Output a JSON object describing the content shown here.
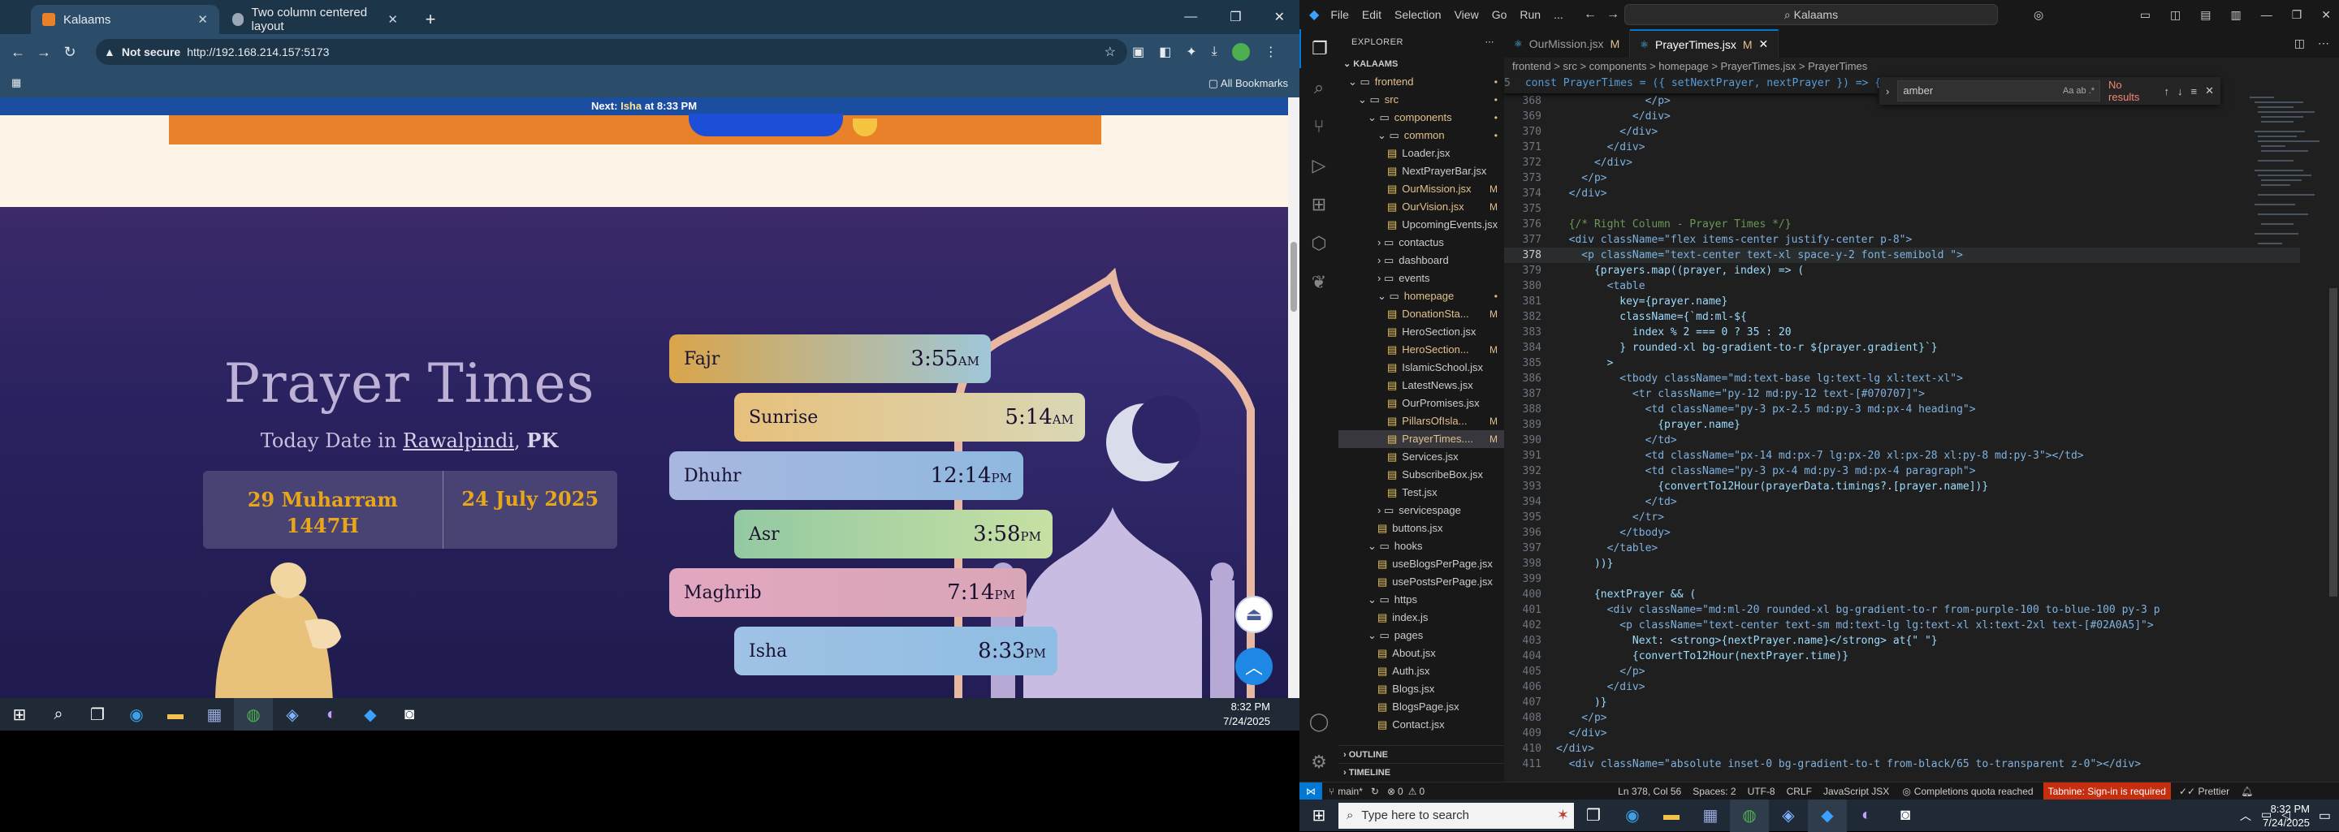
{
  "browser": {
    "tabs": [
      {
        "label": "Kalaams",
        "active": true
      },
      {
        "label": "Two column centered layout",
        "active": false
      }
    ],
    "address": {
      "security": "Not secure",
      "url": "http://192.168.214.157:5173"
    },
    "bookmarks_label": "All Bookmarks"
  },
  "page": {
    "next_bar": {
      "prefix": "Next:",
      "prayer": "Isha",
      "middle": "at",
      "time": "8:33 PM"
    },
    "title": "Prayer Times",
    "date_prefix": "Today Date in",
    "city": "Rawalpindi",
    "country": "PK",
    "hijri_date": "29 Muharram 1447H",
    "gregorian_date": "24 July 2025",
    "prayers": [
      {
        "name": "Fajr",
        "time": "3:55",
        "ampm": "AM",
        "colors": [
          "#d9a54a",
          "#9fc7d8"
        ]
      },
      {
        "name": "Sunrise",
        "time": "5:14",
        "ampm": "AM",
        "colors": [
          "#e7c07c",
          "#d9d7b6"
        ]
      },
      {
        "name": "Dhuhr",
        "time": "12:14",
        "ampm": "PM",
        "colors": [
          "#a8b7e0",
          "#8fb8df"
        ]
      },
      {
        "name": "Asr",
        "time": "3:58",
        "ampm": "PM",
        "colors": [
          "#93c9a2",
          "#c7e0a3"
        ]
      },
      {
        "name": "Maghrib",
        "time": "7:14",
        "ampm": "PM",
        "colors": [
          "#e2a7c0",
          "#d9a6b7"
        ]
      },
      {
        "name": "Isha",
        "time": "8:33",
        "ampm": "PM",
        "colors": [
          "#9fc2e5",
          "#8fbde3"
        ]
      }
    ]
  },
  "left_taskbar": {
    "time": "8:32 PM",
    "date": "7/24/2025"
  },
  "vscode": {
    "menu": [
      "File",
      "Edit",
      "Selection",
      "View",
      "Go",
      "Run",
      "..."
    ],
    "command_center": "Kalaams",
    "explorer_title": "EXPLORER",
    "workspace": "KALAAMS",
    "tree": [
      {
        "label": "frontend",
        "depth": 1,
        "type": "folder-open",
        "badge": "•"
      },
      {
        "label": "src",
        "depth": 2,
        "type": "folder-open",
        "badge": "•"
      },
      {
        "label": "components",
        "depth": 3,
        "type": "folder-open",
        "badge": "•"
      },
      {
        "label": "common",
        "depth": 4,
        "type": "folder-open",
        "badge": "•"
      },
      {
        "label": "Loader.jsx",
        "depth": 5,
        "type": "file",
        "badge": ""
      },
      {
        "label": "NextPrayerBar.jsx",
        "depth": 5,
        "type": "file",
        "badge": ""
      },
      {
        "label": "OurMission.jsx",
        "depth": 5,
        "type": "file",
        "badge": "M"
      },
      {
        "label": "OurVision.jsx",
        "depth": 5,
        "type": "file",
        "badge": "M"
      },
      {
        "label": "UpcomingEvents.jsx",
        "depth": 5,
        "type": "file",
        "badge": ""
      },
      {
        "label": "contactus",
        "depth": 4,
        "type": "folder",
        "badge": ""
      },
      {
        "label": "dashboard",
        "depth": 4,
        "type": "folder",
        "badge": ""
      },
      {
        "label": "events",
        "depth": 4,
        "type": "folder",
        "badge": ""
      },
      {
        "label": "homepage",
        "depth": 4,
        "type": "folder-open",
        "badge": "•"
      },
      {
        "label": "DonationSta...",
        "depth": 5,
        "type": "file",
        "badge": "M"
      },
      {
        "label": "HeroSection.jsx",
        "depth": 5,
        "type": "file",
        "badge": ""
      },
      {
        "label": "HeroSection...",
        "depth": 5,
        "type": "file",
        "badge": "M"
      },
      {
        "label": "IslamicSchool.jsx",
        "depth": 5,
        "type": "file",
        "badge": ""
      },
      {
        "label": "LatestNews.jsx",
        "depth": 5,
        "type": "file",
        "badge": ""
      },
      {
        "label": "OurPromises.jsx",
        "depth": 5,
        "type": "file",
        "badge": ""
      },
      {
        "label": "PillarsOfIsla...",
        "depth": 5,
        "type": "file",
        "badge": "M"
      },
      {
        "label": "PrayerTimes....",
        "depth": 5,
        "type": "file",
        "badge": "M",
        "selected": true
      },
      {
        "label": "Services.jsx",
        "depth": 5,
        "type": "file",
        "badge": ""
      },
      {
        "label": "SubscribeBox.jsx",
        "depth": 5,
        "type": "file",
        "badge": ""
      },
      {
        "label": "Test.jsx",
        "depth": 5,
        "type": "file",
        "badge": ""
      },
      {
        "label": "servicespage",
        "depth": 4,
        "type": "folder",
        "badge": ""
      },
      {
        "label": "buttons.jsx",
        "depth": 4,
        "type": "file",
        "badge": ""
      },
      {
        "label": "hooks",
        "depth": 3,
        "type": "folder-open",
        "badge": ""
      },
      {
        "label": "useBlogsPerPage.jsx",
        "depth": 4,
        "type": "file",
        "badge": ""
      },
      {
        "label": "usePostsPerPage.jsx",
        "depth": 4,
        "type": "file",
        "badge": ""
      },
      {
        "label": "https",
        "depth": 3,
        "type": "folder-open",
        "badge": ""
      },
      {
        "label": "index.js",
        "depth": 4,
        "type": "file",
        "badge": ""
      },
      {
        "label": "pages",
        "depth": 3,
        "type": "folder-open",
        "badge": ""
      },
      {
        "label": "About.jsx",
        "depth": 4,
        "type": "file",
        "badge": ""
      },
      {
        "label": "Auth.jsx",
        "depth": 4,
        "type": "file",
        "badge": ""
      },
      {
        "label": "Blogs.jsx",
        "depth": 4,
        "type": "file",
        "badge": ""
      },
      {
        "label": "BlogsPage.jsx",
        "depth": 4,
        "type": "file",
        "badge": ""
      },
      {
        "label": "Contact.jsx",
        "depth": 4,
        "type": "file",
        "badge": ""
      }
    ],
    "outline": "OUTLINE",
    "timeline": "TIMELINE",
    "editor_tabs": [
      {
        "label": "OurMission.jsx",
        "badge": "M",
        "active": false
      },
      {
        "label": "PrayerTimes.jsx",
        "badge": "M",
        "active": true
      }
    ],
    "breadcrumbs": "frontend > src > components > homepage > PrayerTimes.jsx > PrayerTimes",
    "sticky": {
      "num": "5",
      "text": "const PrayerTimes = ({ setNextPrayer, nextPrayer }) => {"
    },
    "find": {
      "query": "amber",
      "result": "No results"
    },
    "lines": [
      {
        "n": "368",
        "t": "              </p>"
      },
      {
        "n": "369",
        "t": "            </div>"
      },
      {
        "n": "370",
        "t": "          </div>"
      },
      {
        "n": "371",
        "t": "        </div>"
      },
      {
        "n": "372",
        "t": "      </div>"
      },
      {
        "n": "373",
        "t": "    </p>"
      },
      {
        "n": "374",
        "t": "  </div>"
      },
      {
        "n": "375",
        "t": ""
      },
      {
        "n": "376",
        "t": "  {/* Right Column - Prayer Times */}"
      },
      {
        "n": "377",
        "t": "  <div className=\"flex items-center justify-center p-8\">"
      },
      {
        "n": "378",
        "t": "    <p className=\"text-center text-xl space-y-2 font-semibold \">"
      },
      {
        "n": "379",
        "t": "      {prayers.map((prayer, index) => ("
      },
      {
        "n": "380",
        "t": "        <table"
      },
      {
        "n": "381",
        "t": "          key={prayer.name}"
      },
      {
        "n": "382",
        "t": "          className={`md:ml-${"
      },
      {
        "n": "383",
        "t": "            index % 2 === 0 ? 35 : 20"
      },
      {
        "n": "384",
        "t": "          } rounded-xl bg-gradient-to-r ${prayer.gradient}`}"
      },
      {
        "n": "385",
        "t": "        >"
      },
      {
        "n": "386",
        "t": "          <tbody className=\"md:text-base lg:text-lg xl:text-xl\">"
      },
      {
        "n": "387",
        "t": "            <tr className=\"py-12 md:py-12 text-[#070707]\">"
      },
      {
        "n": "388",
        "t": "              <td className=\"py-3 px-2.5 md:py-3 md:px-4 heading\">"
      },
      {
        "n": "389",
        "t": "                {prayer.name}"
      },
      {
        "n": "390",
        "t": "              </td>"
      },
      {
        "n": "391",
        "t": "              <td className=\"px-14 md:px-7 lg:px-20 xl:px-28 xl:py-8 md:py-3\"></td>"
      },
      {
        "n": "392",
        "t": "              <td className=\"py-3 px-4 md:py-3 md:px-4 paragraph\">"
      },
      {
        "n": "393",
        "t": "                {convertTo12Hour(prayerData.timings?.[prayer.name])}"
      },
      {
        "n": "394",
        "t": "              </td>"
      },
      {
        "n": "395",
        "t": "            </tr>"
      },
      {
        "n": "396",
        "t": "          </tbody>"
      },
      {
        "n": "397",
        "t": "        </table>"
      },
      {
        "n": "398",
        "t": "      ))}"
      },
      {
        "n": "399",
        "t": ""
      },
      {
        "n": "400",
        "t": "      {nextPrayer && ("
      },
      {
        "n": "401",
        "t": "        <div className=\"md:ml-20 rounded-xl bg-gradient-to-r from-purple-100 to-blue-100 py-3 p"
      },
      {
        "n": "402",
        "t": "          <p className=\"text-center text-sm md:text-lg lg:text-xl xl:text-2xl text-[#02A0A5]\">"
      },
      {
        "n": "403",
        "t": "            Next: <strong>{nextPrayer.name}</strong> at{\" \"}"
      },
      {
        "n": "404",
        "t": "            {convertTo12Hour(nextPrayer.time)}"
      },
      {
        "n": "405",
        "t": "          </p>"
      },
      {
        "n": "406",
        "t": "        </div>"
      },
      {
        "n": "407",
        "t": "      )}"
      },
      {
        "n": "408",
        "t": "    </p>"
      },
      {
        "n": "409",
        "t": "  </div>"
      },
      {
        "n": "410",
        "t": "</div>"
      },
      {
        "n": "411",
        "t": "  <div className=\"absolute inset-0 bg-gradient-to-t from-black/65 to-transparent z-0\"></div>"
      }
    ],
    "current_line": "378",
    "status": {
      "branch": "main*",
      "errors": "0",
      "warnings": "0",
      "position": "Ln 378, Col 56",
      "spaces": "Spaces: 2",
      "encoding": "UTF-8",
      "eol": "CRLF",
      "language": "JavaScript JSX",
      "quota": "Completions quota reached",
      "tabnine": "Tabnine: Sign-in is required",
      "prettier": "Prettier"
    }
  },
  "right_taskbar": {
    "search_placeholder": "Type here to search",
    "time": "8:32 PM",
    "date": "7/24/2025"
  }
}
